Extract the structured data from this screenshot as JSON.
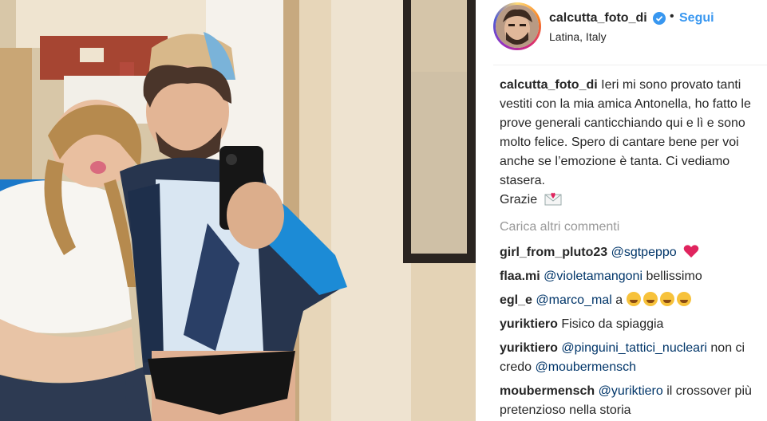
{
  "header": {
    "username": "calcutta_foto_di",
    "separator": "•",
    "follow_label": "Segui",
    "location": "Latina, Italy"
  },
  "caption": {
    "username": "calcutta_foto_di",
    "text": "Ieri mi sono provato tanti vestiti con la mia amica Antonella, ho fatto le prove generali canticchiando qui e lì e sono molto felice. Spero di cantare bene per voi anche se l’emozione è tanta. Ci vediamo stasera.",
    "sign_off": "Grazie"
  },
  "load_more_label": "Carica altri commenti",
  "comments": [
    {
      "user": "girl_from_pluto23",
      "mention": "@sgtpeppo",
      "text": ""
    },
    {
      "user": "flaa.mi",
      "mention": "@violetamangoni",
      "text": "bellissimo"
    },
    {
      "user": "egl_e",
      "mention": "@marco_mal",
      "text": "a"
    },
    {
      "user": "yuriktiero",
      "mention": "",
      "text": "Fisico da spiaggia"
    },
    {
      "user": "yuriktiero",
      "mention": "@pinguini_tattici_nucleari",
      "text": "non ci credo",
      "mention2": "@moubermensch"
    },
    {
      "user": "moubermensch",
      "mention": "@yuriktiero",
      "text": "il crossover più pretenzioso nella storia"
    }
  ],
  "colors": {
    "link_blue": "#3897f0",
    "mention_blue": "#003569",
    "text": "#262626",
    "muted": "#999999"
  },
  "icons": {
    "verified": "verified-badge-icon",
    "heart": "red-heart-icon",
    "envelope": "envelope-with-heart-icon",
    "laugh": "tears-of-joy-icon"
  }
}
